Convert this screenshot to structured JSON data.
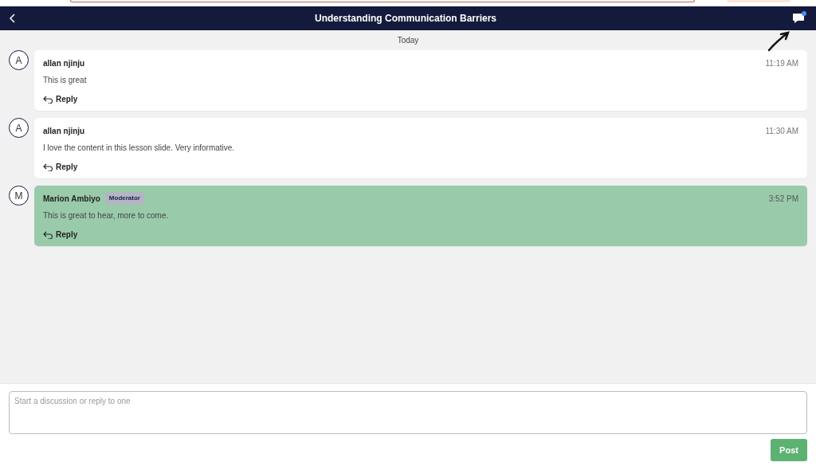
{
  "header": {
    "title": "Understanding Communication Barriers",
    "notification_dot": true
  },
  "date_divider": "Today",
  "messages": [
    {
      "initial": "A",
      "author": "allan njinju",
      "time": "11:19 AM",
      "text": "This is great",
      "reply_label": "Reply",
      "highlighted": false
    },
    {
      "initial": "A",
      "author": "allan njinju",
      "time": "11:30 AM",
      "text": "I love the content in this lesson slide. Very informative.",
      "reply_label": "Reply",
      "highlighted": false
    },
    {
      "initial": "M",
      "author": "Marion Ambiyo",
      "badge": "Moderator",
      "time": "3:52 PM",
      "text": "This is great to hear, more to come.",
      "reply_label": "Reply",
      "highlighted": true
    }
  ],
  "composer": {
    "placeholder": "Start a discussion or reply to one",
    "button": "Post"
  }
}
